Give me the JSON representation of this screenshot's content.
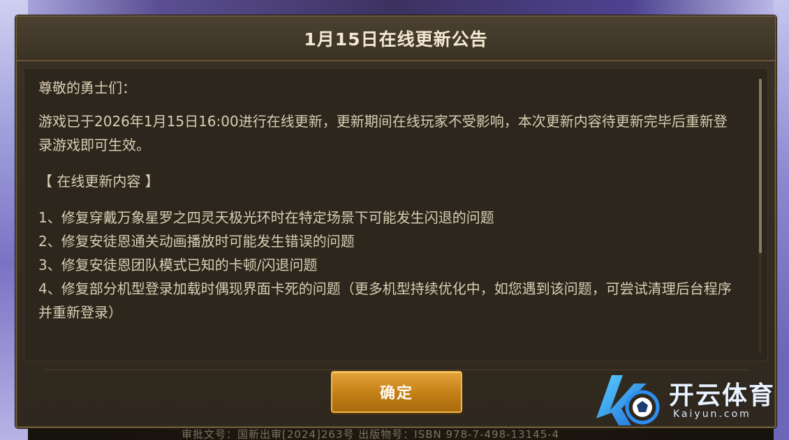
{
  "dialog": {
    "title": "1月15日在线更新公告",
    "greeting": "尊敬的勇士们：",
    "intro": "游戏已于2026年1月15日16:00进行在线更新，更新期间在线玩家不受影响，本次更新内容待更新完毕后重新登录游戏即可生效。",
    "section_title": "【 在线更新内容 】",
    "items": [
      "1、修复穿戴万象星罗之四灵天极光环时在特定场景下可能发生闪退的问题",
      "2、修复安徒恩通关动画播放时可能发生错误的问题",
      "3、修复安徒恩团队模式已知的卡顿/闪退问题",
      "4、修复部分机型登录加载时偶现界面卡死的问题（更多机型持续优化中，如您遇到该问题，可尝试清理后台程序并重新登录）"
    ],
    "confirm_label": "确定"
  },
  "background": {
    "footer_text": "审批文号：国新出审[2024]263号 出版物号：ISBN 978-7-498-13145-4"
  },
  "watermark": {
    "brand": "开云体育",
    "domain": "Kaiyun.com"
  },
  "colors": {
    "accent": "#d28c1e",
    "panel": "#2f281e",
    "text": "#d9cdb4",
    "title": "#f3e9d2"
  }
}
